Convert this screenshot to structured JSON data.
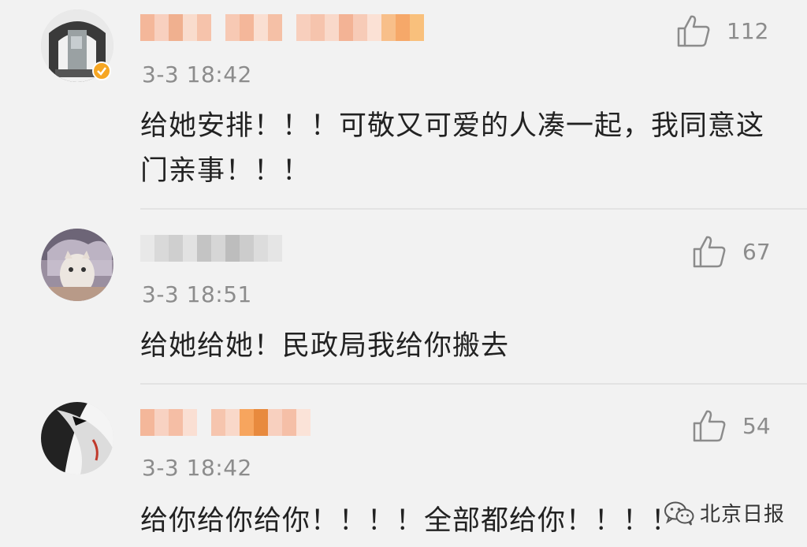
{
  "comments": [
    {
      "time": "3-3 18:42",
      "text": "给她安排！！！可敬又可爱的人凑一起，我同意这门亲事！！！",
      "likes": "112",
      "verified": true,
      "icon": "thumbs-up-icon"
    },
    {
      "time": "3-3 18:51",
      "text": "给她给她！民政局我给你搬去",
      "likes": "67",
      "verified": false,
      "icon": "thumbs-up-icon"
    },
    {
      "time": "3-3 18:42",
      "text": "给你给你给你！！！！全部都给你！！！！",
      "likes": "54",
      "verified": false,
      "icon": "thumbs-up-icon"
    }
  ],
  "watermark": {
    "text": "北京日报",
    "icon": "wechat-icon"
  },
  "colors": {
    "background": "#f2f2f2",
    "text": "#222222",
    "meta": "#8c8c8c",
    "verified": "#f6a623"
  }
}
